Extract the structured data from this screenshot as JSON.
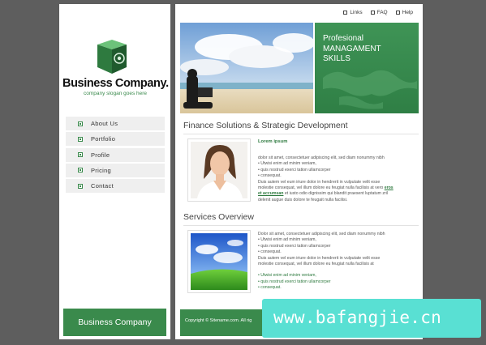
{
  "sidebar": {
    "brand_name": "Business Company.",
    "brand_slogan": "company slogan goes here",
    "nav": [
      "About Us",
      "Portfolio",
      "Profile",
      "Pricing",
      "Contact"
    ],
    "footer_label": "Business Company"
  },
  "header": {
    "links": [
      "Links",
      "FAQ",
      "Help"
    ],
    "hero_lines": [
      "Profesional",
      "MANAGAMENT",
      "SKILLS"
    ]
  },
  "finance": {
    "heading": "Finance Solutions & Strategic Development",
    "subtitle": "Lorem ipsum",
    "line1": "dolor sit amet, consectetuer adipiscing elit, sed diam nonummy nibh",
    "bullet1": "• Utwisi enim ad minim veniam,",
    "bullet2": "• quis nostrud exerci tation ullamcorper",
    "bullet3": "• consequat.",
    "para1": "Duis autem vel eum iriure dolor in hendrerit in vulputate velit esse",
    "para2": "molestie consequat, vel illum dolore eu feugiat nulla facilisis at vero",
    "para2_link": "eros",
    "para3_link": "et accumsan",
    "para3": "et iusto odio dignissim qui blandit praesent luptatum zril",
    "para4": "delenit augue duis dolore te feugait nulla facilisi."
  },
  "services": {
    "heading": "Services Overview",
    "line1": "Dolor sit amet, consectetuer adipiscing elit, sed diam nonummy nibh",
    "bullet1": "• Utwisi enim ad minim veniam,",
    "bullet2": "• quis nostrud exerci tation ullamcorper",
    "bullet3": "• consequat.",
    "para1": "Duis autem vel eum iriure dolor in hendrerit in vulputate velit esse",
    "para2": "molestie consequat, vel illum dolore eu feugiat nulla facilisis at",
    "gbullet1": "• Utwisi enim ad minim veniam,",
    "gbullet2": "• quis nostrud exerci tation ullamcorper",
    "gbullet3": "• consequat."
  },
  "footer": {
    "copyright": "Copyright © Sitename.com. All rig"
  },
  "watermark": "www.bafangjie.cn",
  "colors": {
    "brand_green": "#3a8a4c",
    "background": "#5e5e5e",
    "watermark_bg": "#59e0d3"
  },
  "icons": [
    "cube-logo-icon",
    "nav-bullet-icon",
    "link-bullet-icon"
  ]
}
